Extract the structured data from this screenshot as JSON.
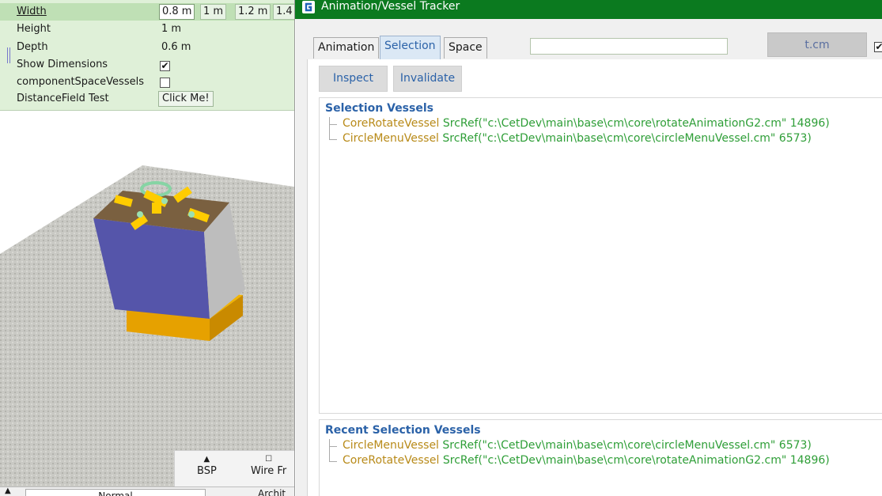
{
  "properties": {
    "width_label": "Width",
    "width_options": [
      "0.8 m",
      "1 m",
      "1.2 m",
      "1.4"
    ],
    "height_label": "Height",
    "height_value": "1 m",
    "depth_label": "Depth",
    "depth_value": "0.6 m",
    "show_dimensions_label": "Show Dimensions",
    "show_dimensions_checked": "✔",
    "component_space_label": "componentSpaceVessels",
    "distance_field_label": "DistanceField Test",
    "click_me_label": "Click Me!"
  },
  "viewport": {
    "bsp_label": "BSP",
    "wire_label": "Wire Fr",
    "bsp_icon": "▲",
    "wire_icon": "☐",
    "mode_select": "Normal",
    "mode_arch": "Archit",
    "up_icon": "▲"
  },
  "tracker": {
    "title": "Animation/Vessel Tracker",
    "tabs": [
      "Animation",
      "Selection",
      "Space"
    ],
    "active_tab": "Selection",
    "search_value": "",
    "tcm_button": "t.cm",
    "right_checkbox": "✔",
    "inspect_button": "Inspect",
    "invalidate_button": "Invalidate",
    "selection_heading": "Selection Vessels",
    "selection_vessels": [
      {
        "name": "CoreRotateVessel",
        "ref": " SrcRef(\"c:\\CetDev\\main\\base\\cm\\core\\rotateAnimationG2.cm\" 14896)"
      },
      {
        "name": "CircleMenuVessel",
        "ref": " SrcRef(\"c:\\CetDev\\main\\base\\cm\\core\\circleMenuVessel.cm\" 6573)"
      }
    ],
    "recent_heading": "Recent Selection Vessels",
    "recent_vessels": [
      {
        "name": "CircleMenuVessel",
        "ref": " SrcRef(\"c:\\CetDev\\main\\base\\cm\\core\\circleMenuVessel.cm\" 6573)"
      },
      {
        "name": "CoreRotateVessel",
        "ref": " SrcRef(\"c:\\CetDev\\main\\base\\cm\\core\\rotateAnimationG2.cm\" 14896)"
      }
    ]
  },
  "colors": {
    "title_bar": "#0b7a1f",
    "panel_green": "#dff0d8",
    "heading_blue": "#2b62a8",
    "vessel_name": "#b88a18",
    "vessel_ref": "#2e9e37"
  }
}
